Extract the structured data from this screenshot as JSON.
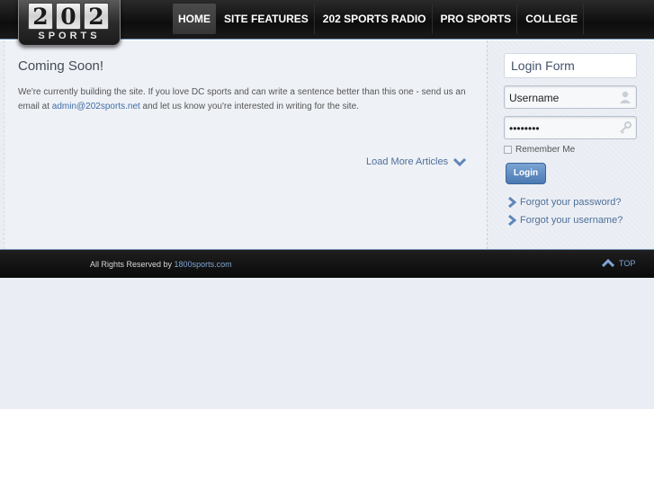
{
  "logo": {
    "digits": [
      "2",
      "0",
      "2"
    ],
    "word": "SPORTS"
  },
  "nav": {
    "items": [
      {
        "label": "HOME"
      },
      {
        "label": "SITE FEATURES"
      },
      {
        "label": "202 SPORTS RADIO"
      },
      {
        "label": "PRO SPORTS"
      },
      {
        "label": "COLLEGE"
      }
    ]
  },
  "content": {
    "title": "Coming Soon!",
    "body_before": "We're currently building the site.  If you love DC sports and can write a sentence better than this one - send us an email at ",
    "email": "admin@202sports.net",
    "body_after": " and let us know you're interested in writing for the site.",
    "load_more": "Load More Articles"
  },
  "login": {
    "title": "Login Form",
    "username_value": "Username",
    "password_value": "••••••••",
    "remember_label": "Remember Me",
    "button_label": "Login",
    "forgot_password": "Forgot your password?",
    "forgot_username": "Forgot your username?"
  },
  "footer": {
    "text": "All Rights Reserved by ",
    "link": "1800sports.com",
    "top_label": "TOP"
  },
  "colors": {
    "accent": "#4b79b2",
    "link": "#4f6f9a",
    "header_bg": "#0d0d0d"
  }
}
